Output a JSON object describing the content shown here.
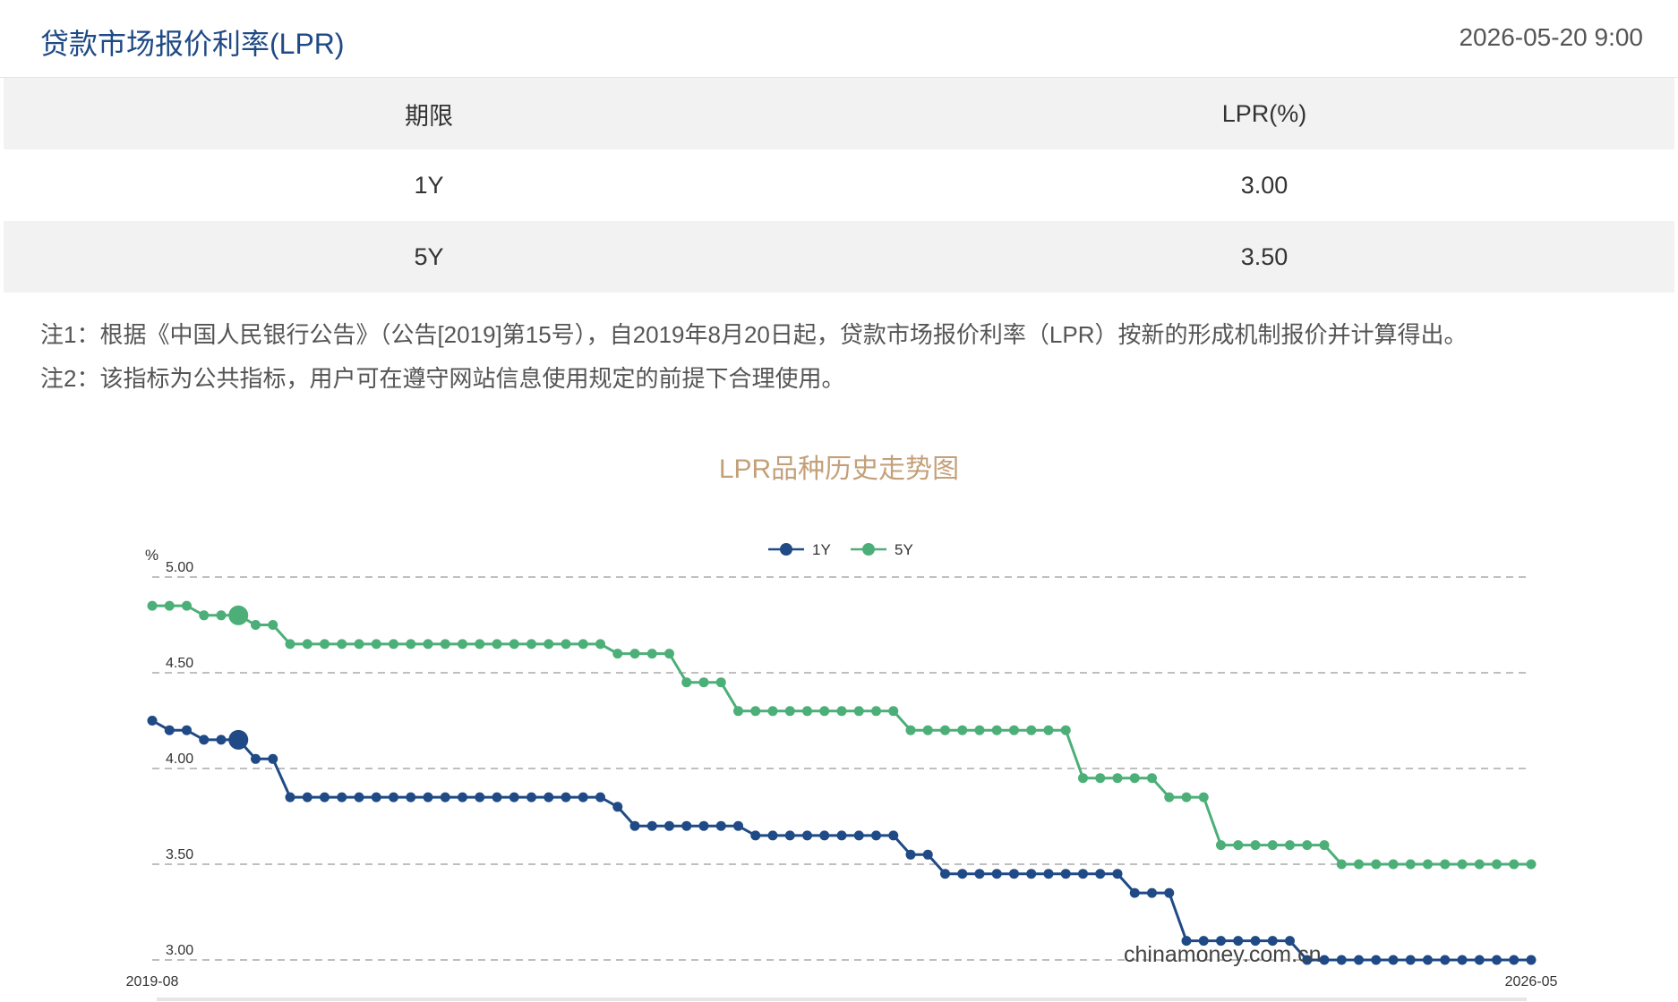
{
  "header": {
    "title": "贷款市场报价利率(LPR)",
    "datetime": "2026-05-20 9:00"
  },
  "table": {
    "headers": [
      "期限",
      "LPR(%)"
    ],
    "rows": [
      {
        "term": "1Y",
        "rate": "3.00"
      },
      {
        "term": "5Y",
        "rate": "3.50"
      }
    ]
  },
  "notes": [
    "注1：根据《中国人民银行公告》（公告[2019]第15号），自2019年8月20日起，贷款市场报价利率（LPR）按新的形成机制报价并计算得出。",
    "注2：该指标为公共指标，用户可在遵守网站信息使用规定的前提下合理使用。"
  ],
  "colors": {
    "title": "#1f4a86",
    "chart_title": "#c4a07a",
    "series_1y": "#1f4a86",
    "series_5y": "#4caf78"
  },
  "chart_data": {
    "type": "line",
    "title": "LPR品种历史走势图",
    "ylabel": "%",
    "ylim": [
      3.0,
      5.0
    ],
    "yticks": [
      "3.00",
      "3.50",
      "4.00",
      "4.50",
      "5.00"
    ],
    "grid": true,
    "legend_position": "top-center",
    "watermark": "chinamoney.com.cn",
    "x_labels": [
      "2019-08",
      "2026-05"
    ],
    "series": [
      {
        "name": "1Y",
        "values": [
          4.25,
          4.2,
          4.2,
          4.15,
          4.15,
          4.15,
          4.05,
          4.05,
          3.85,
          3.85,
          3.85,
          3.85,
          3.85,
          3.85,
          3.85,
          3.85,
          3.85,
          3.85,
          3.85,
          3.85,
          3.85,
          3.85,
          3.85,
          3.85,
          3.85,
          3.85,
          3.85,
          3.8,
          3.7,
          3.7,
          3.7,
          3.7,
          3.7,
          3.7,
          3.7,
          3.65,
          3.65,
          3.65,
          3.65,
          3.65,
          3.65,
          3.65,
          3.65,
          3.65,
          3.55,
          3.55,
          3.45,
          3.45,
          3.45,
          3.45,
          3.45,
          3.45,
          3.45,
          3.45,
          3.45,
          3.45,
          3.45,
          3.35,
          3.35,
          3.35,
          3.1,
          3.1,
          3.1,
          3.1,
          3.1,
          3.1,
          3.1,
          3.0,
          3.0,
          3.0,
          3.0,
          3.0,
          3.0,
          3.0,
          3.0,
          3.0,
          3.0,
          3.0,
          3.0,
          3.0,
          3.0
        ]
      },
      {
        "name": "5Y",
        "values": [
          4.85,
          4.85,
          4.85,
          4.8,
          4.8,
          4.8,
          4.75,
          4.75,
          4.65,
          4.65,
          4.65,
          4.65,
          4.65,
          4.65,
          4.65,
          4.65,
          4.65,
          4.65,
          4.65,
          4.65,
          4.65,
          4.65,
          4.65,
          4.65,
          4.65,
          4.65,
          4.65,
          4.6,
          4.6,
          4.6,
          4.6,
          4.45,
          4.45,
          4.45,
          4.3,
          4.3,
          4.3,
          4.3,
          4.3,
          4.3,
          4.3,
          4.3,
          4.3,
          4.3,
          4.2,
          4.2,
          4.2,
          4.2,
          4.2,
          4.2,
          4.2,
          4.2,
          4.2,
          4.2,
          3.95,
          3.95,
          3.95,
          3.95,
          3.95,
          3.85,
          3.85,
          3.85,
          3.6,
          3.6,
          3.6,
          3.6,
          3.6,
          3.6,
          3.6,
          3.5,
          3.5,
          3.5,
          3.5,
          3.5,
          3.5,
          3.5,
          3.5,
          3.5,
          3.5,
          3.5,
          3.5
        ]
      }
    ]
  }
}
